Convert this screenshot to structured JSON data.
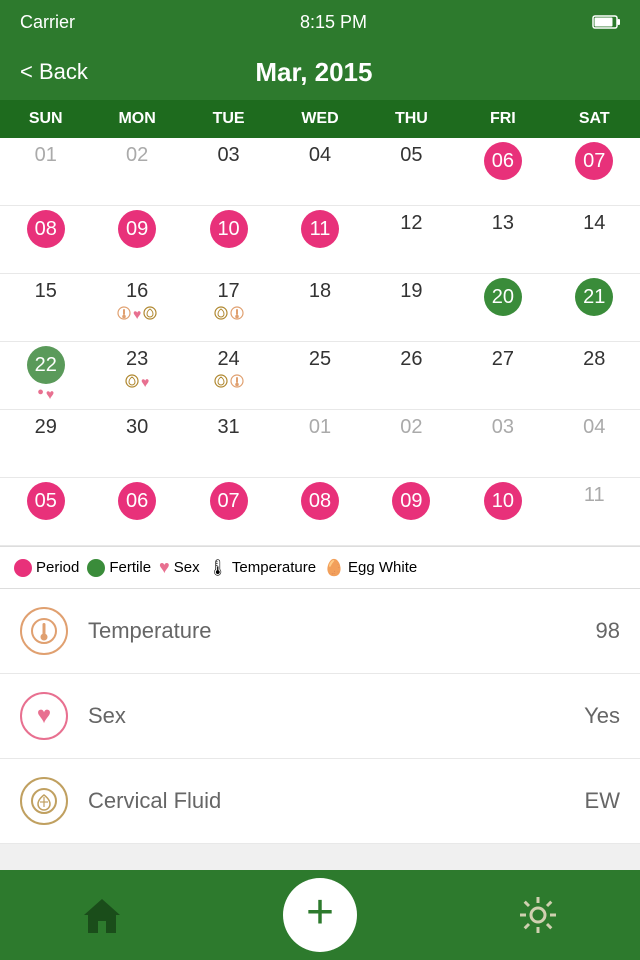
{
  "statusBar": {
    "carrier": "Carrier",
    "wifi": "wifi",
    "time": "8:15 PM",
    "battery": "battery"
  },
  "navBar": {
    "backLabel": "< Back",
    "title": "Mar, 2015"
  },
  "dayHeaders": [
    "SUN",
    "MON",
    "TUE",
    "WED",
    "THU",
    "FRI",
    "SAT"
  ],
  "weeks": [
    [
      {
        "date": "01",
        "grey": true,
        "periodHighlight": false,
        "fertile": false,
        "icons": []
      },
      {
        "date": "02",
        "grey": true,
        "periodHighlight": false,
        "fertile": false,
        "icons": []
      },
      {
        "date": "03",
        "grey": false,
        "periodHighlight": false,
        "fertile": false,
        "icons": []
      },
      {
        "date": "04",
        "grey": false,
        "periodHighlight": false,
        "fertile": false,
        "icons": []
      },
      {
        "date": "05",
        "grey": false,
        "periodHighlight": false,
        "fertile": false,
        "icons": []
      },
      {
        "date": "06",
        "grey": false,
        "periodHighlight": true,
        "fertile": false,
        "icons": []
      },
      {
        "date": "07",
        "grey": false,
        "periodHighlight": true,
        "fertile": false,
        "icons": []
      }
    ],
    [
      {
        "date": "08",
        "grey": false,
        "periodHighlight": true,
        "fertile": false,
        "icons": []
      },
      {
        "date": "09",
        "grey": false,
        "periodHighlight": true,
        "fertile": false,
        "icons": []
      },
      {
        "date": "10",
        "grey": false,
        "periodHighlight": true,
        "fertile": false,
        "icons": []
      },
      {
        "date": "11",
        "grey": false,
        "periodHighlight": true,
        "fertile": false,
        "icons": []
      },
      {
        "date": "12",
        "grey": false,
        "periodHighlight": false,
        "fertile": false,
        "icons": []
      },
      {
        "date": "13",
        "grey": false,
        "periodHighlight": false,
        "fertile": false,
        "icons": []
      },
      {
        "date": "14",
        "grey": false,
        "periodHighlight": false,
        "fertile": false,
        "icons": []
      }
    ],
    [
      {
        "date": "15",
        "grey": false,
        "periodHighlight": false,
        "fertile": false,
        "icons": []
      },
      {
        "date": "16",
        "grey": false,
        "periodHighlight": false,
        "fertile": false,
        "icons": [
          "temp",
          "heart",
          "egg"
        ]
      },
      {
        "date": "17",
        "grey": false,
        "periodHighlight": false,
        "fertile": false,
        "icons": [
          "egg",
          "temp"
        ]
      },
      {
        "date": "18",
        "grey": false,
        "periodHighlight": false,
        "fertile": false,
        "icons": []
      },
      {
        "date": "19",
        "grey": false,
        "periodHighlight": false,
        "fertile": false,
        "icons": []
      },
      {
        "date": "20",
        "grey": false,
        "periodHighlight": false,
        "fertile": true,
        "icons": []
      },
      {
        "date": "21",
        "grey": false,
        "periodHighlight": false,
        "fertile": true,
        "icons": []
      }
    ],
    [
      {
        "date": "22",
        "grey": false,
        "periodHighlight": false,
        "fertile": false,
        "icons": [
          "period",
          "heart"
        ],
        "greenCircle": true
      },
      {
        "date": "23",
        "grey": false,
        "periodHighlight": false,
        "fertile": false,
        "icons": [
          "egg",
          "heart"
        ]
      },
      {
        "date": "24",
        "grey": false,
        "periodHighlight": false,
        "fertile": false,
        "icons": [
          "egg",
          "temp"
        ]
      },
      {
        "date": "25",
        "grey": false,
        "periodHighlight": false,
        "fertile": false,
        "icons": []
      },
      {
        "date": "26",
        "grey": false,
        "periodHighlight": false,
        "fertile": false,
        "icons": []
      },
      {
        "date": "27",
        "grey": false,
        "periodHighlight": false,
        "fertile": false,
        "icons": []
      },
      {
        "date": "28",
        "grey": false,
        "periodHighlight": false,
        "fertile": false,
        "icons": []
      }
    ],
    [
      {
        "date": "29",
        "grey": false,
        "periodHighlight": false,
        "fertile": false,
        "icons": []
      },
      {
        "date": "30",
        "grey": false,
        "periodHighlight": false,
        "fertile": false,
        "icons": []
      },
      {
        "date": "31",
        "grey": false,
        "periodHighlight": false,
        "fertile": false,
        "icons": []
      },
      {
        "date": "01",
        "grey": true,
        "periodHighlight": false,
        "fertile": false,
        "icons": []
      },
      {
        "date": "02",
        "grey": true,
        "periodHighlight": false,
        "fertile": false,
        "icons": []
      },
      {
        "date": "03",
        "grey": true,
        "periodHighlight": false,
        "fertile": false,
        "icons": []
      },
      {
        "date": "04",
        "grey": true,
        "periodHighlight": false,
        "fertile": false,
        "icons": []
      }
    ],
    [
      {
        "date": "05",
        "grey": false,
        "periodHighlight": true,
        "fertile": false,
        "icons": []
      },
      {
        "date": "06",
        "grey": false,
        "periodHighlight": true,
        "fertile": false,
        "icons": []
      },
      {
        "date": "07",
        "grey": false,
        "periodHighlight": true,
        "fertile": false,
        "icons": []
      },
      {
        "date": "08",
        "grey": false,
        "periodHighlight": true,
        "fertile": false,
        "icons": []
      },
      {
        "date": "09",
        "grey": false,
        "periodHighlight": true,
        "fertile": false,
        "icons": []
      },
      {
        "date": "10",
        "grey": false,
        "periodHighlight": true,
        "fertile": false,
        "icons": []
      },
      {
        "date": "11",
        "grey": true,
        "periodHighlight": false,
        "fertile": false,
        "icons": []
      }
    ]
  ],
  "legend": [
    {
      "type": "dot",
      "color": "period",
      "label": "Period"
    },
    {
      "type": "dot",
      "color": "fertile",
      "label": "Fertile"
    },
    {
      "type": "heart",
      "label": "Sex"
    },
    {
      "type": "temp",
      "label": "Temperature"
    },
    {
      "type": "egg",
      "label": "Egg White"
    }
  ],
  "infoRows": [
    {
      "icon": "temp",
      "label": "Temperature",
      "value": "98"
    },
    {
      "icon": "sex",
      "label": "Sex",
      "value": "Yes"
    },
    {
      "icon": "cervical",
      "label": "Cervical Fluid",
      "value": "EW"
    }
  ],
  "bottomBar": {
    "homeLabel": "Home",
    "addLabel": "+",
    "settingsLabel": "Settings"
  }
}
